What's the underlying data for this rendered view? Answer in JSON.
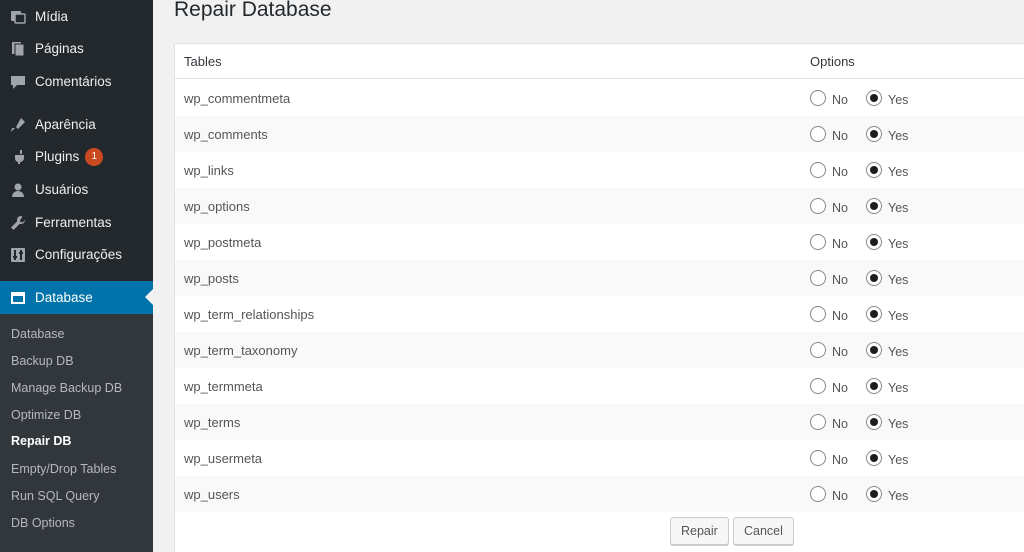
{
  "sidebar": {
    "items": [
      {
        "label": "Mídia",
        "icon": "media-icon"
      },
      {
        "label": "Páginas",
        "icon": "pages-icon"
      },
      {
        "label": "Comentários",
        "icon": "comments-icon"
      },
      {
        "label": "Aparência",
        "icon": "appearance-icon"
      },
      {
        "label": "Plugins",
        "icon": "plugins-icon",
        "badge": "1"
      },
      {
        "label": "Usuários",
        "icon": "users-icon"
      },
      {
        "label": "Ferramentas",
        "icon": "tools-icon"
      },
      {
        "label": "Configurações",
        "icon": "settings-icon"
      },
      {
        "label": "Database",
        "icon": "database-icon",
        "current": true
      }
    ],
    "submenu": [
      {
        "label": "Database"
      },
      {
        "label": "Backup DB"
      },
      {
        "label": "Manage Backup DB"
      },
      {
        "label": "Optimize DB"
      },
      {
        "label": "Repair DB",
        "active": true
      },
      {
        "label": "Empty/Drop Tables"
      },
      {
        "label": "Run SQL Query"
      },
      {
        "label": "DB Options"
      }
    ]
  },
  "main": {
    "title": "Repair Database",
    "columns": {
      "tables": "Tables",
      "options": "Options"
    },
    "option_labels": {
      "no": "No",
      "yes": "Yes"
    },
    "rows": [
      {
        "table": "wp_commentmeta",
        "selected": "yes"
      },
      {
        "table": "wp_comments",
        "selected": "yes"
      },
      {
        "table": "wp_links",
        "selected": "yes"
      },
      {
        "table": "wp_options",
        "selected": "yes"
      },
      {
        "table": "wp_postmeta",
        "selected": "yes"
      },
      {
        "table": "wp_posts",
        "selected": "yes"
      },
      {
        "table": "wp_term_relationships",
        "selected": "yes"
      },
      {
        "table": "wp_term_taxonomy",
        "selected": "yes"
      },
      {
        "table": "wp_termmeta",
        "selected": "yes"
      },
      {
        "table": "wp_terms",
        "selected": "yes"
      },
      {
        "table": "wp_usermeta",
        "selected": "yes"
      },
      {
        "table": "wp_users",
        "selected": "yes"
      }
    ],
    "buttons": {
      "repair": "Repair",
      "cancel": "Cancel"
    }
  },
  "colors": {
    "sidebar_bg": "#23282d",
    "submenu_bg": "#32373c",
    "accent": "#0073aa",
    "badge": "#ca4a1f"
  }
}
